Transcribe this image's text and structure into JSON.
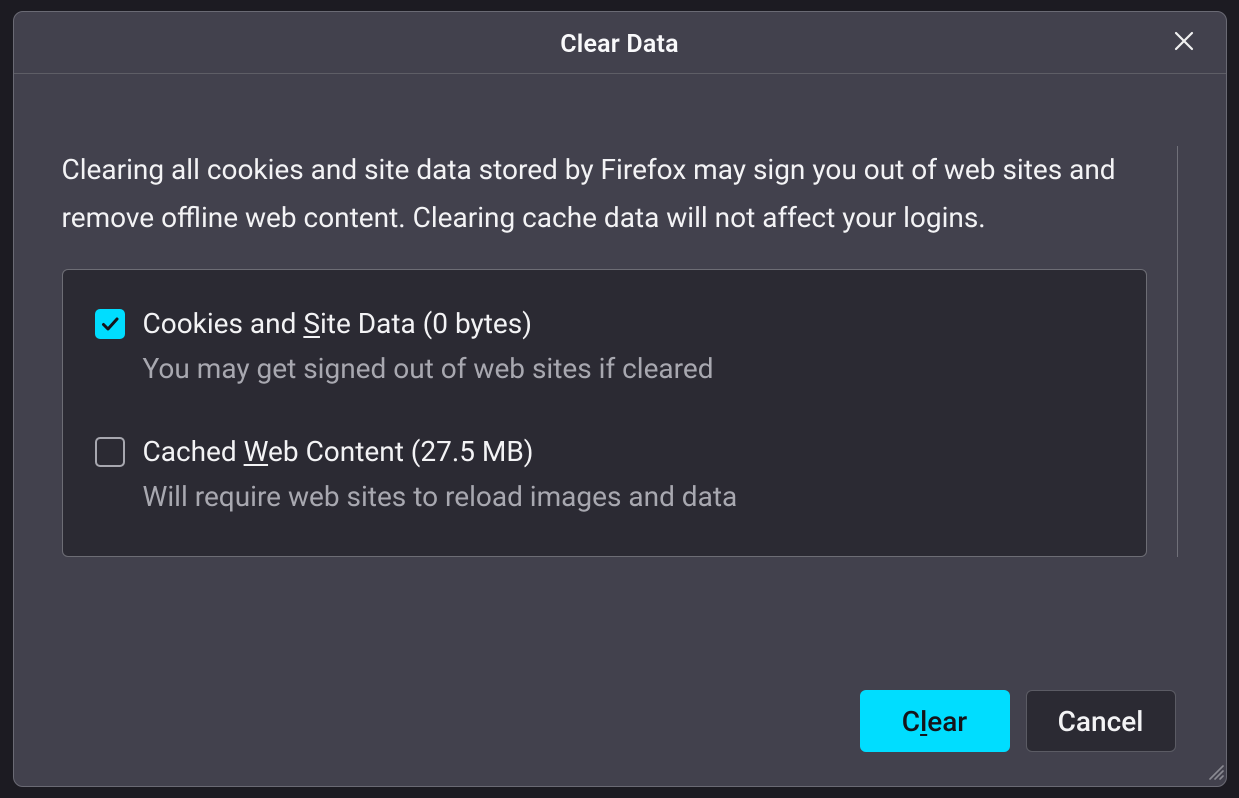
{
  "dialog": {
    "title": "Clear Data",
    "description": "Clearing all cookies and site data stored by Firefox may sign you out of web sites and remove offline web content. Clearing cache data will not affect your logins.",
    "options": [
      {
        "checked": true,
        "label_pre": "Cookies and ",
        "label_u": "S",
        "label_post": "ite Data (0 bytes)",
        "sub": "You may get signed out of web sites if cleared"
      },
      {
        "checked": false,
        "label_pre": "Cached ",
        "label_u": "W",
        "label_post": "eb Content (27.5 MB)",
        "sub": "Will require web sites to reload images and data"
      }
    ],
    "buttons": {
      "primary_pre": "C",
      "primary_u": "l",
      "primary_post": "ear",
      "secondary": "Cancel"
    }
  }
}
